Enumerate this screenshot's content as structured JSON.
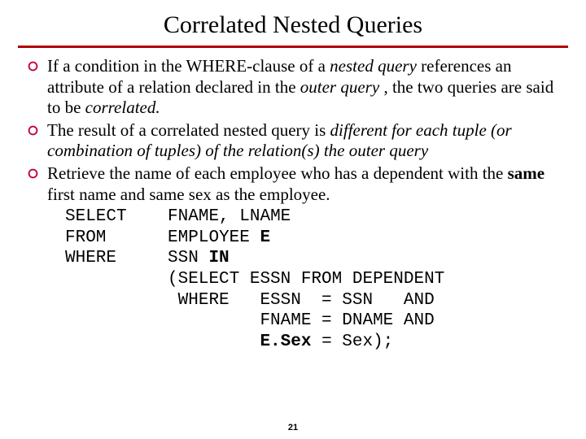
{
  "title": "Correlated Nested Queries",
  "bullets": [
    {
      "pre": "If a condition in the WHERE-clause of a ",
      "i1": "nested query",
      "mid1": " references an attribute of a relation declared in the ",
      "i2": "outer query",
      "mid2": " , the two queries are said to be ",
      "i3": "correlated.",
      "post": ""
    },
    {
      "pre": "The result of a correlated nested query is ",
      "i1": "different for each tuple (or combination of tuples) of the relation(s) the outer query",
      "post": ""
    },
    {
      "pre": "Retrieve the name of each employee who has a dependent with the ",
      "b1": "same",
      "post": " first name and same sex as the employee."
    }
  ],
  "sql": {
    "l1a": "SELECT",
    "l1b": "FNAME, LNAME",
    "l2a": "FROM",
    "l2b": "EMPLOYEE ",
    "l2c": "E",
    "l3a": "WHERE",
    "l3b": "SSN ",
    "l3c": "IN",
    "l4": "(SELECT ESSN FROM DEPENDENT",
    "l5": " WHERE   ESSN  = SSN   AND",
    "l6": "         FNAME = DNAME AND",
    "l7a": "         ",
    "l7b": "E.Sex",
    "l7c": " = Sex);"
  },
  "page": "21"
}
